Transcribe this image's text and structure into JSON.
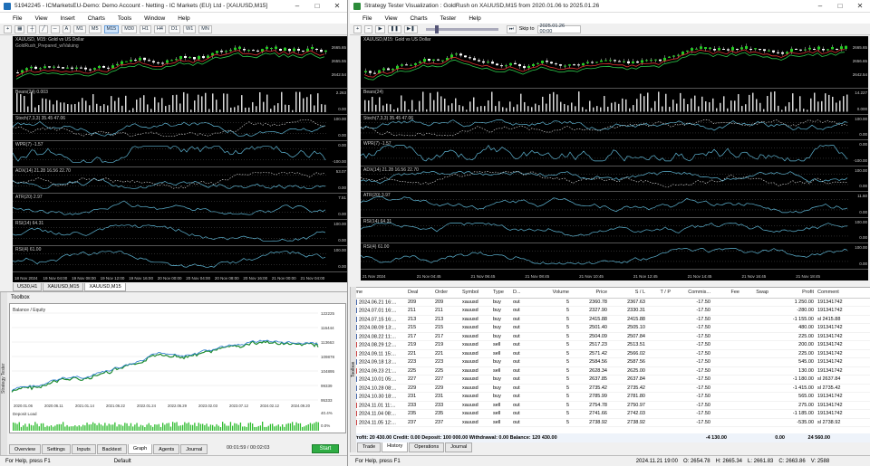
{
  "left_window": {
    "title": "51942245 - ICMarketsEU-Demo: Demo Account - Netting - IC Markets (EU) Ltd - [XAUUSD,M15]",
    "menu": [
      "File",
      "View",
      "Insert",
      "Charts",
      "Tools",
      "Window",
      "Help"
    ],
    "timeframes": [
      "M1",
      "M5",
      "M15",
      "M30",
      "H1",
      "H4",
      "D1",
      "W1",
      "MN"
    ],
    "active_timeframe": "M15",
    "chart": {
      "symbol_label": "XAUUSD, M15: Gold vs US Dollar",
      "ea_label": "GoldRush_Prepared_w/Valuing",
      "panes": [
        {
          "label": "Bears(24) 0.003",
          "levels": [
            "2.263",
            "0.00"
          ]
        },
        {
          "label": "Stoch(7,3,3) 35.45 47.06",
          "levels": [
            "100.00",
            "0.00"
          ]
        },
        {
          "label": "WPR(7) -1.57",
          "levels": [
            "0.00",
            "-100.00"
          ]
        },
        {
          "label": "ADX(14) 21.28 16.56 22.70",
          "levels": [
            "53.07",
            "0.00"
          ]
        },
        {
          "label": "ATR(20) 2.97",
          "levels": [
            "7.51",
            "0.00"
          ]
        },
        {
          "label": "RSI(14) 64.31",
          "levels": [
            "100.00",
            "0.00"
          ]
        },
        {
          "label": "RSI(4) 61.00",
          "levels": [
            "100.00",
            "0.00"
          ]
        }
      ],
      "price_levels": [
        "2665.65",
        "2655.55",
        "2642.54"
      ],
      "x_labels": [
        "18 Nov 2024",
        "19 Nov 04:00",
        "19 Nov 08:00",
        "19 Nov 12:00",
        "19 Nov 16:00",
        "20 Nov 00:00",
        "20 Nov 04:00",
        "20 Nov 08:00",
        "20 Nov 16:00",
        "21 Nov 00:00",
        "21 Nov 04:00"
      ]
    },
    "chart_tabs": [
      "US30,H1",
      "XAUUSD,M15",
      "XAUUSD,M15"
    ],
    "active_chart_tab": 2,
    "toolbox": {
      "header": "Toolbox",
      "graph_label": "Balance / Equity",
      "graph_y": [
        "122225",
        "116444",
        "113663",
        "109878",
        "104895",
        "99339",
        "95333"
      ],
      "graph_x": [
        "2020.01.06",
        "2020.06.11",
        "2021.01.14",
        "2021.06.22",
        "2022.01.24",
        "2022.06.29",
        "2023.02.03",
        "2023.07.12",
        "2024.02.12",
        "2024.09.20"
      ],
      "deposit_label": "Deposit Load",
      "deposit_y": [
        "40.4%",
        "0.0%"
      ],
      "tabs": [
        "Overview",
        "Settings",
        "Inputs",
        "Backtest",
        "Graph",
        "Agents",
        "Journal"
      ],
      "active_tab": "Graph",
      "progress": "00:01:59 / 00:02:03",
      "start_label": "Start",
      "side_label": "Strategy Tester"
    },
    "status": {
      "help": "For Help, press F1",
      "profile": "Default"
    }
  },
  "right_window": {
    "title": "Strategy Tester Visualization : GoldRush on XAUUSD,M15 from 2020.01.06 to 2025.01.26",
    "menu": [
      "File",
      "View",
      "Charts",
      "Tester",
      "Help"
    ],
    "skip_to_label": "Skip to",
    "skip_to_value": "2025.01.26 00:00",
    "chart": {
      "symbol_label": "XAUUSD,M15: Gold vs US Dollar",
      "panes": [
        {
          "label": "Bears(24)",
          "levels": [
            "14.227",
            "0.000"
          ]
        },
        {
          "label": "Stoch(7,3,3) 35.45 47.06",
          "levels": [
            "100.00",
            "0.00"
          ]
        },
        {
          "label": "WPR(7) -1.57",
          "levels": [
            "0.00",
            "-100.00"
          ]
        },
        {
          "label": "ADX(14) 21.28 16.56 22.70",
          "levels": [
            "100.00",
            "0.00"
          ]
        },
        {
          "label": "ATR(20) 3.97",
          "levels": [
            "11.60",
            "0.00"
          ]
        },
        {
          "label": "RSI(14) 64.31",
          "levels": [
            "100.00",
            "0.00"
          ]
        },
        {
          "label": "RSI(4) 61.00",
          "levels": [
            "100.00",
            "0.00"
          ]
        }
      ],
      "price_levels": [
        "2665.65",
        "2656.65",
        "2642.54"
      ],
      "x_labels": [
        "21 Nov 2024",
        "21 Nov 04:45",
        "21 Nov 06:45",
        "21 Nov 08:45",
        "21 Nov 10:45",
        "21 Nov 12:45",
        "21 Nov 14:45",
        "21 Nov 16:45",
        "21 Nov 18:45"
      ]
    },
    "history": {
      "columns": [
        "Time",
        "Deal",
        "Order",
        "Symbol",
        "Type",
        "D...",
        "Volume",
        "Price",
        "S / L",
        "T / P",
        "Commis...",
        "Fee",
        "Swap",
        "Profit",
        "Comment"
      ],
      "rows": [
        [
          "2024.06.21 16:...",
          "209",
          "209",
          "xauusd",
          "buy",
          "out",
          "5",
          "2360.78",
          "2367.63",
          "",
          "-17.50",
          "",
          "",
          "1 250.00",
          "191341742"
        ],
        [
          "2024.07.01 16:...",
          "211",
          "211",
          "xauusd",
          "buy",
          "out",
          "5",
          "2327.90",
          "2330.31",
          "",
          "-17.50",
          "",
          "",
          "-280.00",
          "191341742"
        ],
        [
          "2024.07.15 16:...",
          "213",
          "213",
          "xauusd",
          "buy",
          "out",
          "5",
          "2415.88",
          "2415.88",
          "",
          "-17.50",
          "",
          "",
          "-1 155.00",
          "sl 2415.88"
        ],
        [
          "2024.08.09 13:...",
          "215",
          "215",
          "xauusd",
          "buy",
          "out",
          "5",
          "2501.40",
          "2505.10",
          "",
          "-17.50",
          "",
          "",
          "480.00",
          "191341742"
        ],
        [
          "2024.08.22 11:...",
          "217",
          "217",
          "xauusd",
          "buy",
          "out",
          "5",
          "2504.09",
          "2507.84",
          "",
          "-17.50",
          "",
          "",
          "225.00",
          "191341742"
        ],
        [
          "2024.08.29 12:...",
          "219",
          "219",
          "xauusd",
          "sell",
          "out",
          "5",
          "2517.23",
          "2513.51",
          "",
          "-17.50",
          "",
          "",
          "200.00",
          "191341742"
        ],
        [
          "2024.09.11 15:...",
          "221",
          "221",
          "xauusd",
          "sell",
          "out",
          "5",
          "2571.42",
          "2566.02",
          "",
          "-17.50",
          "",
          "",
          "225.00",
          "191341742"
        ],
        [
          "2024.09.18 13:...",
          "223",
          "223",
          "xauusd",
          "buy",
          "out",
          "5",
          "2584.56",
          "2587.56",
          "",
          "-17.50",
          "",
          "",
          "545.00",
          "191341742"
        ],
        [
          "2024.09.23 21:...",
          "225",
          "225",
          "xauusd",
          "sell",
          "out",
          "5",
          "2628.34",
          "2625.00",
          "",
          "-17.50",
          "",
          "",
          "130.00",
          "191341742"
        ],
        [
          "2024.10.01 05:...",
          "227",
          "227",
          "xauusd",
          "buy",
          "out",
          "5",
          "2637.85",
          "2637.84",
          "",
          "-17.50",
          "",
          "",
          "-1 180.00",
          "sl 2637.84"
        ],
        [
          "2024.10.28 08:...",
          "229",
          "229",
          "xauusd",
          "buy",
          "out",
          "5",
          "2735.42",
          "2735.42",
          "",
          "-17.50",
          "",
          "",
          "-1 415.00",
          "sl 2735.42"
        ],
        [
          "2024.10.30 18:...",
          "231",
          "231",
          "xauusd",
          "buy",
          "out",
          "5",
          "2785.99",
          "2781.80",
          "",
          "-17.50",
          "",
          "",
          "565.00",
          "191341742"
        ],
        [
          "2024.11.01 11:...",
          "233",
          "233",
          "xauusd",
          "sell",
          "out",
          "5",
          "2754.78",
          "2750.97",
          "",
          "-17.50",
          "",
          "",
          "275.00",
          "191341742"
        ],
        [
          "2024.11.04 08:...",
          "235",
          "235",
          "xauusd",
          "sell",
          "out",
          "5",
          "2741.66",
          "2742.03",
          "",
          "-17.50",
          "",
          "",
          "-1 185.00",
          "191341742"
        ],
        [
          "2024.11.05 12:...",
          "237",
          "237",
          "xauusd",
          "sell",
          "out",
          "5",
          "2738.92",
          "2738.92",
          "",
          "-17.50",
          "",
          "",
          "-535.00",
          "sl 2738.92"
        ]
      ],
      "summary": "Profit: 20 430.00   Credit: 0.00   Deposit: 100 000.00   Withdrawal: 0.00   Balance: 120 430.00",
      "summary_comm": "-4 130.00",
      "summary_swap": "0.00",
      "summary_profit": "24 560.00",
      "tabs": [
        "Trade",
        "History",
        "Operations",
        "Journal"
      ],
      "active_tab": "History",
      "side_label": "Toolbox"
    },
    "status": {
      "help": "For Help, press F1",
      "time": "2024.11.21 19:00",
      "open": "O: 2654.78",
      "high": "H: 2665.34",
      "low": "L: 2661.83",
      "close": "C: 2663.86",
      "volume": "V: 2588"
    }
  },
  "colors": {
    "chart_bg": "#000000",
    "bull": "#22cc22",
    "bear": "#ffffff",
    "ma_red": "#e03030",
    "ma_green": "#2cc84a",
    "ind": "#5fb7d6",
    "balance": "#2b7bd0",
    "equity": "#1a8a2e",
    "start": "#2eac43"
  }
}
